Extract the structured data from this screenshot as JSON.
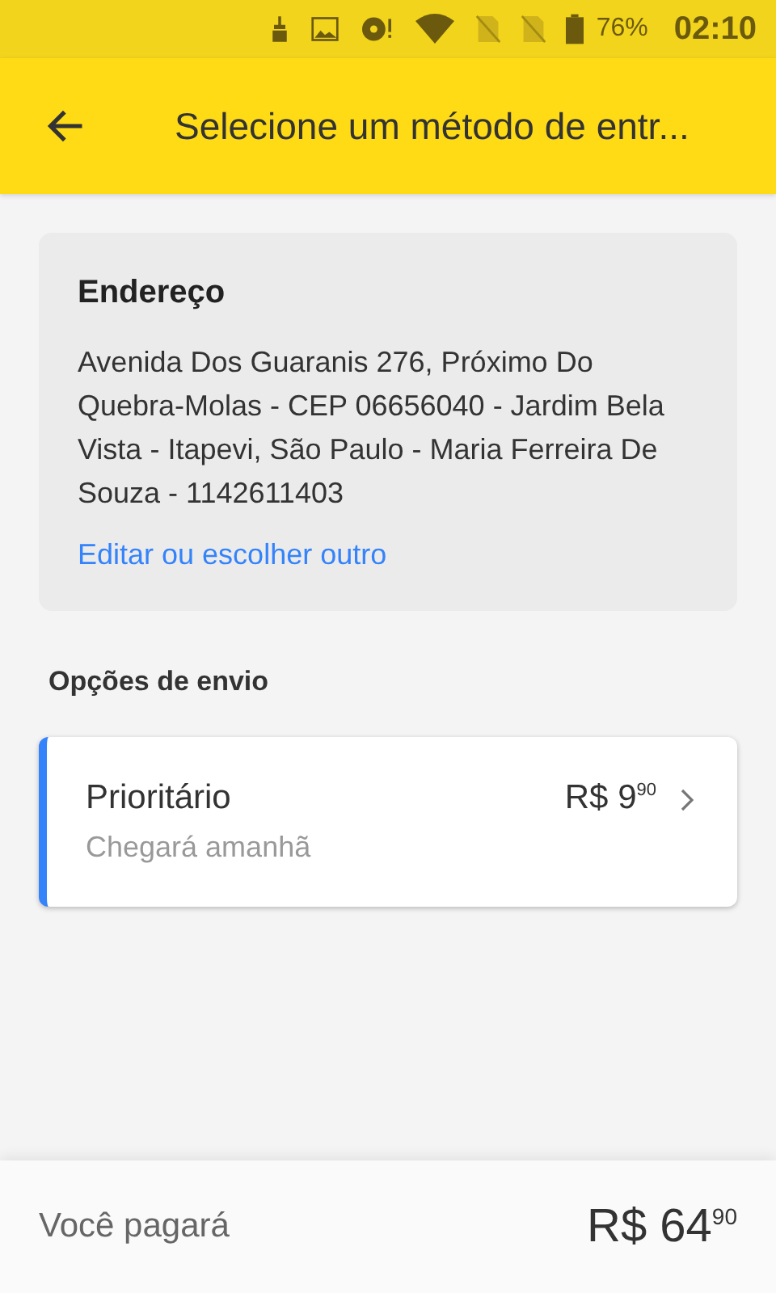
{
  "status_bar": {
    "battery": "76%",
    "time": "02:10"
  },
  "app_bar": {
    "title": "Selecione um método de entr..."
  },
  "address_card": {
    "title": "Endereço",
    "address": "Avenida Dos Guaranis 276, Próximo Do Quebra-Molas - CEP 06656040 - Jardim Bela Vista - Itapevi, São Paulo - Maria Ferreira De Souza - 1142611403",
    "link": "Editar ou escolher outro"
  },
  "shipping": {
    "heading": "Opções de envio",
    "options": [
      {
        "name": "Prioritário",
        "price": "R$ 9$^{90}$",
        "eta": "Chegará amanhã",
        "selected": true
      }
    ]
  },
  "footer": {
    "label": "Você pagará",
    "total": "R$ 64$^{90}$"
  }
}
